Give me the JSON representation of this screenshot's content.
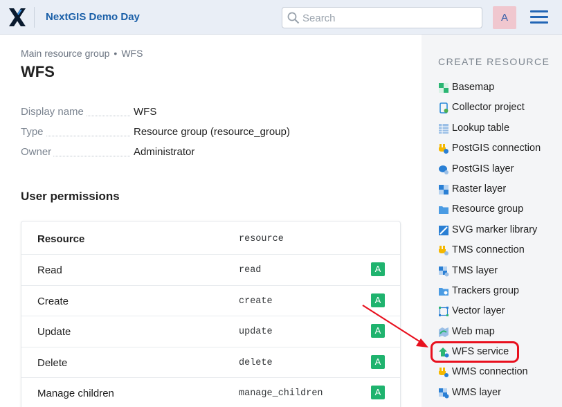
{
  "header": {
    "logo_icon": "nextgis-x-logo-icon",
    "app_title": "NextGIS Demo Day",
    "search_placeholder": "Search",
    "search_value": "",
    "avatar_letter": "A",
    "menu_icon": "hamburger-menu-icon"
  },
  "breadcrumb": {
    "items": [
      "Main resource group",
      "WFS"
    ],
    "separator": "•"
  },
  "page_title": "WFS",
  "info": {
    "rows": [
      {
        "key": "Display name",
        "value": "WFS"
      },
      {
        "key": "Type",
        "value": "Resource group (resource_group)"
      },
      {
        "key": "Owner",
        "value": "Administrator"
      }
    ]
  },
  "permissions": {
    "heading": "User permissions",
    "header": {
      "name": "Resource",
      "code": "resource"
    },
    "rows": [
      {
        "name": "Read",
        "code": "read",
        "badge": "A"
      },
      {
        "name": "Create",
        "code": "create",
        "badge": "A"
      },
      {
        "name": "Update",
        "code": "update",
        "badge": "A"
      },
      {
        "name": "Delete",
        "code": "delete",
        "badge": "A"
      },
      {
        "name": "Manage children",
        "code": "manage_children",
        "badge": "A"
      }
    ]
  },
  "sidebar": {
    "title": "CREATE RESOURCE",
    "items": [
      {
        "label": "Basemap",
        "icon": "basemap-icon"
      },
      {
        "label": "Collector project",
        "icon": "collector-project-icon"
      },
      {
        "label": "Lookup table",
        "icon": "lookup-table-icon"
      },
      {
        "label": "PostGIS connection",
        "icon": "postgis-connection-icon"
      },
      {
        "label": "PostGIS layer",
        "icon": "postgis-layer-icon"
      },
      {
        "label": "Raster layer",
        "icon": "raster-layer-icon"
      },
      {
        "label": "Resource group",
        "icon": "folder-icon"
      },
      {
        "label": "SVG marker library",
        "icon": "svg-marker-library-icon"
      },
      {
        "label": "TMS connection",
        "icon": "tms-connection-icon"
      },
      {
        "label": "TMS layer",
        "icon": "tms-layer-icon"
      },
      {
        "label": "Trackers group",
        "icon": "trackers-group-icon"
      },
      {
        "label": "Vector layer",
        "icon": "vector-layer-icon"
      },
      {
        "label": "Web map",
        "icon": "web-map-icon"
      },
      {
        "label": "WFS service",
        "icon": "wfs-service-icon"
      },
      {
        "label": "WMS connection",
        "icon": "wms-connection-icon"
      },
      {
        "label": "WMS layer",
        "icon": "wms-layer-icon"
      }
    ],
    "highlighted_item": "WFS service"
  },
  "colors": {
    "header_bg": "#e9eef6",
    "brand_blue": "#1a5fa8",
    "badge_green": "#1fb36e",
    "highlight_red": "#e8101e",
    "avatar_bg": "#f0c7cf"
  }
}
